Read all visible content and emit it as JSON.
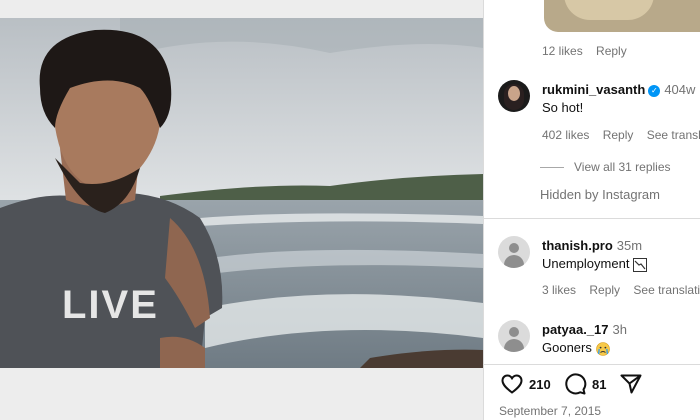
{
  "post": {
    "image_alt": "Man with curly hair and beard wearing grey LIVE t-shirt standing by the sea",
    "shirt_text": "LIVE",
    "likes": "210",
    "comments": "81",
    "date": "September 7, 2015"
  },
  "comments": {
    "previous": {
      "likes": "12 likes",
      "reply": "Reply"
    },
    "items": [
      {
        "username": "rukmini_vasanth",
        "verified": true,
        "time": "404w",
        "text": "So hot!",
        "likes": "402 likes",
        "reply": "Reply",
        "translate": "See translation"
      },
      {
        "username": "thanish.pro",
        "time": "35m",
        "text": "Unemployment",
        "emoji": "chart-decreasing",
        "likes": "3 likes",
        "reply": "Reply",
        "translate": "See translation"
      },
      {
        "username": "patyaa._17",
        "time": "3h",
        "text": "Gooners",
        "emoji": "crying-face"
      }
    ],
    "view_replies": "View all 31 replies",
    "hidden_by": "Hidden by Instagram"
  },
  "colors": {
    "verified": "#0095f6",
    "muted": "#737373",
    "divider": "#dbdbdb"
  }
}
